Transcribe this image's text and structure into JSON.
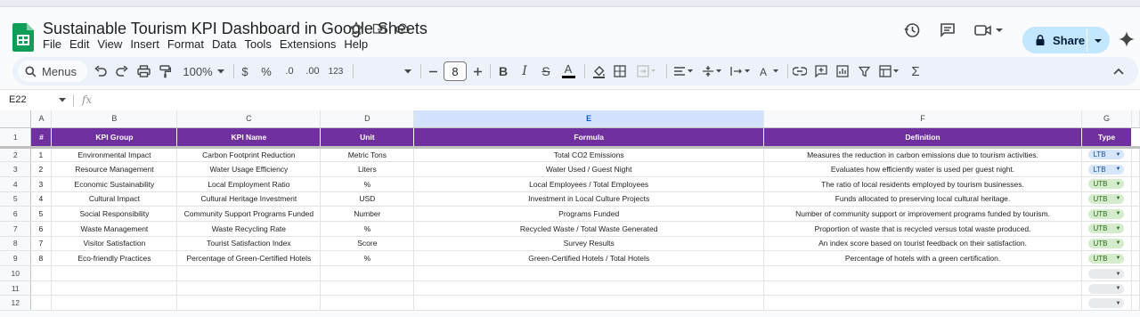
{
  "document": {
    "title": "Sustainable Tourism KPI Dashboard in Google Sheets"
  },
  "menu": [
    "File",
    "Edit",
    "View",
    "Insert",
    "Format",
    "Data",
    "Tools",
    "Extensions",
    "Help"
  ],
  "share_label": "Share",
  "toolbar": {
    "menus_label": "Menus",
    "zoom": "100%",
    "currency": "$",
    "percent": "%",
    "decimal_decrease": ".0",
    "decimal_increase": ".00",
    "number_format": "123",
    "font_size": "8"
  },
  "name_box": "E22",
  "formula_icon": "fx",
  "columns": [
    "A",
    "B",
    "C",
    "D",
    "E",
    "F",
    "G"
  ],
  "header_row": [
    "#",
    "KPI Group",
    "KPI Name",
    "Unit",
    "Formula",
    "Definition",
    "Type"
  ],
  "rows": [
    {
      "n": "1",
      "group": "Environmental Impact",
      "name": "Carbon Footprint Reduction",
      "unit": "Metric Tons",
      "formula": "Total CO2 Emissions",
      "definition": "Measures the reduction in carbon emissions due to tourism activities.",
      "type": "LTB"
    },
    {
      "n": "2",
      "group": "Resource Management",
      "name": "Water Usage Efficiency",
      "unit": "Liters",
      "formula": "Water Used / Guest Night",
      "definition": "Evaluates how efficiently water is used per guest night.",
      "type": "LTB"
    },
    {
      "n": "3",
      "group": "Economic Sustainability",
      "name": "Local Employment Ratio",
      "unit": "%",
      "formula": "Local Employees / Total Employees",
      "definition": "The ratio of local residents employed by tourism businesses.",
      "type": "UTB"
    },
    {
      "n": "4",
      "group": "Cultural Impact",
      "name": "Cultural Heritage Investment",
      "unit": "USD",
      "formula": "Investment in Local Culture Projects",
      "definition": "Funds allocated to preserving local cultural heritage.",
      "type": "UTB"
    },
    {
      "n": "5",
      "group": "Social Responsibility",
      "name": "Community Support Programs Funded",
      "unit": "Number",
      "formula": "Programs Funded",
      "definition": "Number of community support or improvement programs funded by tourism.",
      "type": "UTB"
    },
    {
      "n": "6",
      "group": "Waste Management",
      "name": "Waste Recycling Rate",
      "unit": "%",
      "formula": "Recycled Waste / Total Waste Generated",
      "definition": "Proportion of waste that is recycled versus total waste produced.",
      "type": "UTB"
    },
    {
      "n": "7",
      "group": "Visitor Satisfaction",
      "name": "Tourist Satisfaction Index",
      "unit": "Score",
      "formula": "Survey Results",
      "definition": "An index score based on tourist feedback on their satisfaction.",
      "type": "UTB"
    },
    {
      "n": "8",
      "group": "Eco-friendly Practices",
      "name": "Percentage of Green-Certified Hotels",
      "unit": "%",
      "formula": "Green-Certified Hotels / Total Hotels",
      "definition": "Percentage of hotels with a green certification.",
      "type": "UTB"
    }
  ],
  "row_numbers": [
    "1",
    "2",
    "3",
    "4",
    "5",
    "6",
    "7",
    "8",
    "9",
    "10",
    "11",
    "12"
  ],
  "colors": {
    "header_bg": "#7030a0",
    "ltb_chip": "#d6e6fb",
    "utb_chip": "#d4eccc",
    "share_bg": "#c2e7ff"
  }
}
